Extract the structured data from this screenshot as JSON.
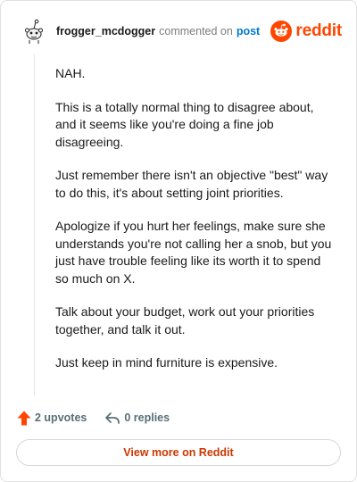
{
  "header": {
    "username": "frogger_mcdogger",
    "action_text": "commented on",
    "post_link": "post",
    "brand_name": "reddit",
    "brand_color": "#ff4500",
    "link_color": "#0079d3"
  },
  "comment": {
    "paragraphs": [
      "NAH.",
      "This is a totally normal thing to disagree about, and it seems like you're doing a fine job disagreeing.",
      "Just remember there isn't an objective \"best\" way to do this, it's about setting joint priorities.",
      "Apologize if you hurt her feelings, make sure she understands you're not calling her a snob, but you just have trouble feeling like its worth it to spend so much on X.",
      "Talk about your budget, work out your priorities together, and talk it out.",
      "Just keep in mind furniture is expensive."
    ]
  },
  "actions": {
    "upvotes": "2 upvotes",
    "replies": "0 replies",
    "upvote_icon": "upvote-arrow-icon",
    "reply_icon": "reply-arrow-icon"
  },
  "footer": {
    "view_more": "View more on Reddit"
  }
}
